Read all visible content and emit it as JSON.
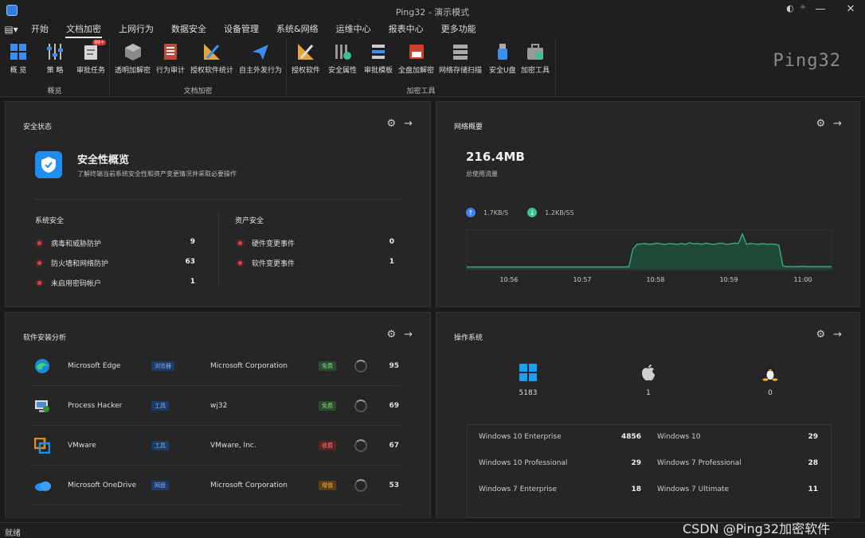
{
  "window": {
    "title": "Ping32 - 演示模式",
    "minimize": "—",
    "close": "✕"
  },
  "menu": [
    "开始",
    "文档加密",
    "上网行为",
    "数据安全",
    "设备管理",
    "系统&网络",
    "运维中心",
    "报表中心",
    "更多功能"
  ],
  "menu_active": 1,
  "ribbon": {
    "groups": [
      {
        "label": "概览",
        "buttons": [
          {
            "label": "概 览",
            "icon": "grid-icon"
          },
          {
            "label": "策 略",
            "icon": "sliders-icon"
          },
          {
            "label": "审批任务",
            "icon": "approval-icon",
            "badge": "99+"
          }
        ]
      },
      {
        "label": "文档加密",
        "buttons": [
          {
            "label": "透明加解密",
            "icon": "cube-icon"
          },
          {
            "label": "行为审计",
            "icon": "audit-icon"
          },
          {
            "label": "授权软件统计",
            "icon": "ruler-icon"
          },
          {
            "label": "自主外发行为",
            "icon": "send-icon"
          }
        ]
      },
      {
        "label": "加密工具",
        "buttons": [
          {
            "label": "授权软件",
            "icon": "ruler-icon"
          },
          {
            "label": "安全属性",
            "icon": "props-icon"
          },
          {
            "label": "审批模板",
            "icon": "template-icon"
          },
          {
            "label": "全盘加解密",
            "icon": "disk-icon"
          },
          {
            "label": "网络存储扫描",
            "icon": "server-icon"
          },
          {
            "label": "安全U盘",
            "icon": "usb-icon"
          },
          {
            "label": "加密工具",
            "icon": "toolbox-icon"
          }
        ]
      }
    ],
    "brand": "Ping32"
  },
  "security": {
    "title": "安全状态",
    "heading": "安全性概览",
    "desc": "了解终端当前系统安全性和资产变更情况并采取必要操作",
    "system": {
      "title": "系统安全",
      "items": [
        {
          "label": "病毒和威胁防护",
          "value": "9"
        },
        {
          "label": "防火墙和网络防护",
          "value": "63"
        },
        {
          "label": "未启用密码帐户",
          "value": "1"
        }
      ]
    },
    "asset": {
      "title": "资产安全",
      "items": [
        {
          "label": "硬件变更事件",
          "value": "0"
        },
        {
          "label": "软件变更事件",
          "value": "1"
        }
      ]
    }
  },
  "network": {
    "title": "网络概要",
    "total": "216.4MB",
    "total_label": "总使用流量",
    "up": "1.7KB/S",
    "down": "1.2KB/SS",
    "colors": {
      "up": "#3b82f6",
      "down": "#3fbf95",
      "line": "#39a57a"
    }
  },
  "chart_data": {
    "type": "area",
    "x": [
      "10:56",
      "10:57",
      "10:58",
      "10:59",
      "11:00"
    ],
    "ylim": [
      0,
      1
    ],
    "series": [
      {
        "values": [
          0.05,
          0.05,
          0.05,
          0.05,
          0.05,
          0.05,
          0.05,
          0.05,
          0.05,
          0.05,
          0.05,
          0.05,
          0.05,
          0.05,
          0.05,
          0.05,
          0.05,
          0.05,
          0.05,
          0.05,
          0.05,
          0.05,
          0.05,
          0.05,
          0.05,
          0.05,
          0.05,
          0.05,
          0.05,
          0.05,
          0.05,
          0.05,
          0.05,
          0.05,
          0.05,
          0.05,
          0.05,
          0.05,
          0.05,
          0.05,
          0.06,
          0.5,
          0.62,
          0.63,
          0.64,
          0.62,
          0.63,
          0.65,
          0.63,
          0.62,
          0.64,
          0.63,
          0.62,
          0.64,
          0.62,
          0.66,
          0.63,
          0.64,
          0.62,
          0.65,
          0.63,
          0.62,
          0.64,
          0.65,
          0.62,
          0.63,
          0.65,
          0.64,
          0.88,
          0.62,
          0.64,
          0.63,
          0.62,
          0.64,
          0.62,
          0.63,
          0.62,
          0.6,
          0.08,
          0.06,
          0.06,
          0.06,
          0.06,
          0.07,
          0.06,
          0.06,
          0.06,
          0.06,
          0.06,
          0.06,
          0.06
        ]
      }
    ]
  },
  "software": {
    "title": "软件安装分析",
    "rows": [
      {
        "name": "Microsoft Edge",
        "cat": "浏览器",
        "vendor": "Microsoft Corporation",
        "license": "免费",
        "lic_type": "green",
        "count": "95",
        "icon": "edge-icon"
      },
      {
        "name": "Process Hacker",
        "cat": "工具",
        "vendor": "wj32",
        "license": "免费",
        "lic_type": "green",
        "count": "69",
        "icon": "process-hacker-icon"
      },
      {
        "name": "VMware",
        "cat": "工具",
        "vendor": "VMware, Inc.",
        "license": "收费",
        "lic_type": "red",
        "count": "67",
        "icon": "vmware-icon"
      },
      {
        "name": "Microsoft OneDrive",
        "cat": "网盘",
        "vendor": "Microsoft Corporation",
        "license": "增值",
        "lic_type": "orange",
        "count": "53",
        "icon": "onedrive-icon"
      }
    ]
  },
  "os": {
    "title": "操作系统",
    "platforms": [
      {
        "icon": "windows-icon",
        "count": "5183"
      },
      {
        "icon": "apple-icon",
        "count": "1"
      },
      {
        "icon": "linux-icon",
        "count": "0"
      }
    ],
    "table": [
      {
        "name": "Windows 10 Enterprise",
        "value": "4856"
      },
      {
        "name": "Windows 10",
        "value": "29"
      },
      {
        "name": "Windows 10 Professional",
        "value": "29"
      },
      {
        "name": "Windows 7 Professional",
        "value": "28"
      },
      {
        "name": "Windows 7 Enterprise",
        "value": "18"
      },
      {
        "name": "Windows 7 Ultimate",
        "value": "11"
      }
    ]
  },
  "status": {
    "left": "就绪",
    "watermark": "CSDN @Ping32加密软件"
  }
}
